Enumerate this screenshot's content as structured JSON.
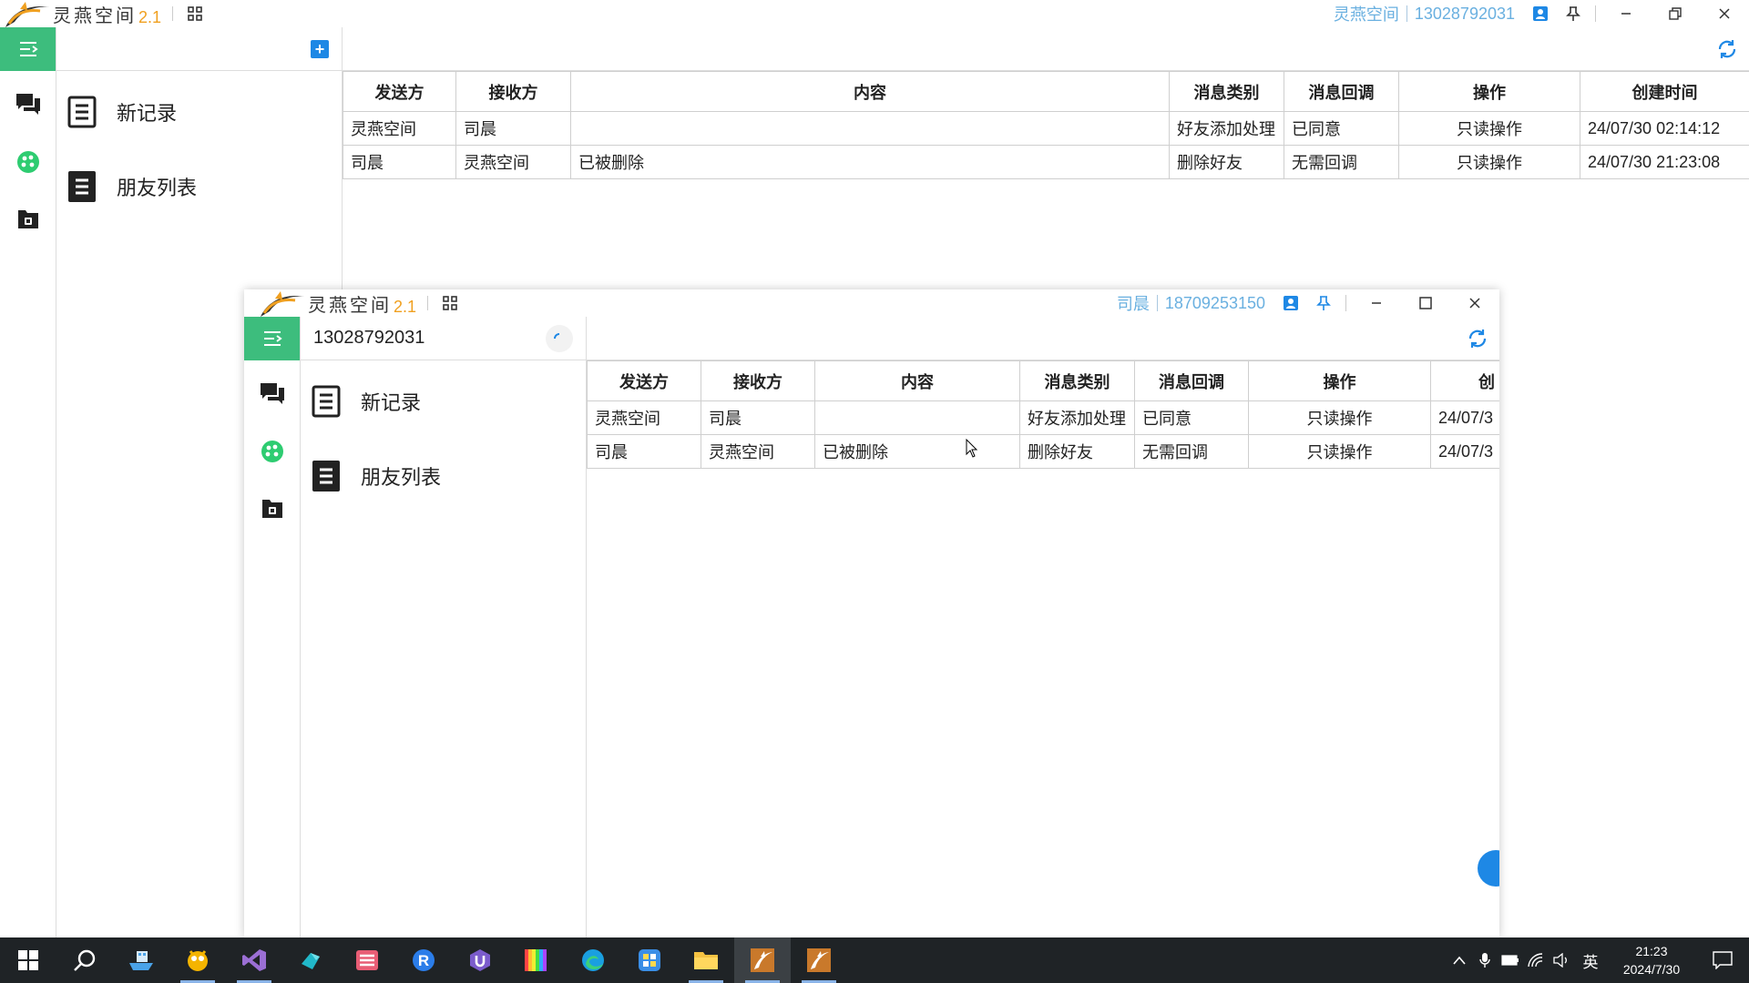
{
  "app": {
    "name": "灵燕空间",
    "version": "2.1"
  },
  "main_window": {
    "user_name": "灵燕空间",
    "user_phone": "13028792031",
    "menu_items": [
      {
        "label": "新记录"
      },
      {
        "label": "朋友列表"
      }
    ]
  },
  "second_window": {
    "user_name": "司晨",
    "user_phone": "18709253150",
    "menu_title": "13028792031",
    "menu_items": [
      {
        "label": "新记录"
      },
      {
        "label": "朋友列表"
      }
    ]
  },
  "table": {
    "columns": [
      "发送方",
      "接收方",
      "内容",
      "消息类别",
      "消息回调",
      "操作",
      "创建时间"
    ],
    "second_window_columns": [
      "发送方",
      "接收方",
      "内容",
      "消息类别",
      "消息回调",
      "操作",
      "创"
    ],
    "rows": [
      {
        "sender": "灵燕空间",
        "receiver": "司晨",
        "content": "",
        "type": "好友添加处理",
        "callback": "已同意",
        "action": "只读操作",
        "created": "24/07/30 02:14:12",
        "created_truncated": "24/07/3"
      },
      {
        "sender": "司晨",
        "receiver": "灵燕空间",
        "content": "已被删除",
        "type": "删除好友",
        "callback": "无需回调",
        "action": "只读操作",
        "created": "24/07/30 21:23:08",
        "created_truncated": "24/07/3"
      }
    ]
  },
  "taskbar": {
    "apps": [
      "start-icon",
      "search-icon",
      "ship-app-icon",
      "bird-app-icon",
      "visual-studio-icon",
      "app-icon-teal",
      "stack-app-icon",
      "r-app-icon",
      "u-app-icon",
      "color-bars-app-icon",
      "edge-icon",
      "box-app-icon",
      "file-explorer-icon",
      "lingyan-app-icon",
      "lingyan-app-icon-2"
    ],
    "ime": "英",
    "time": "21:23",
    "date": "2024/7/30"
  },
  "colors": {
    "accent_green": "#3dbd7d",
    "accent_blue": "#1e88e5",
    "user_text": "#6ab0e0",
    "version_orange": "#f0a020",
    "taskbar": "#1f2326"
  }
}
